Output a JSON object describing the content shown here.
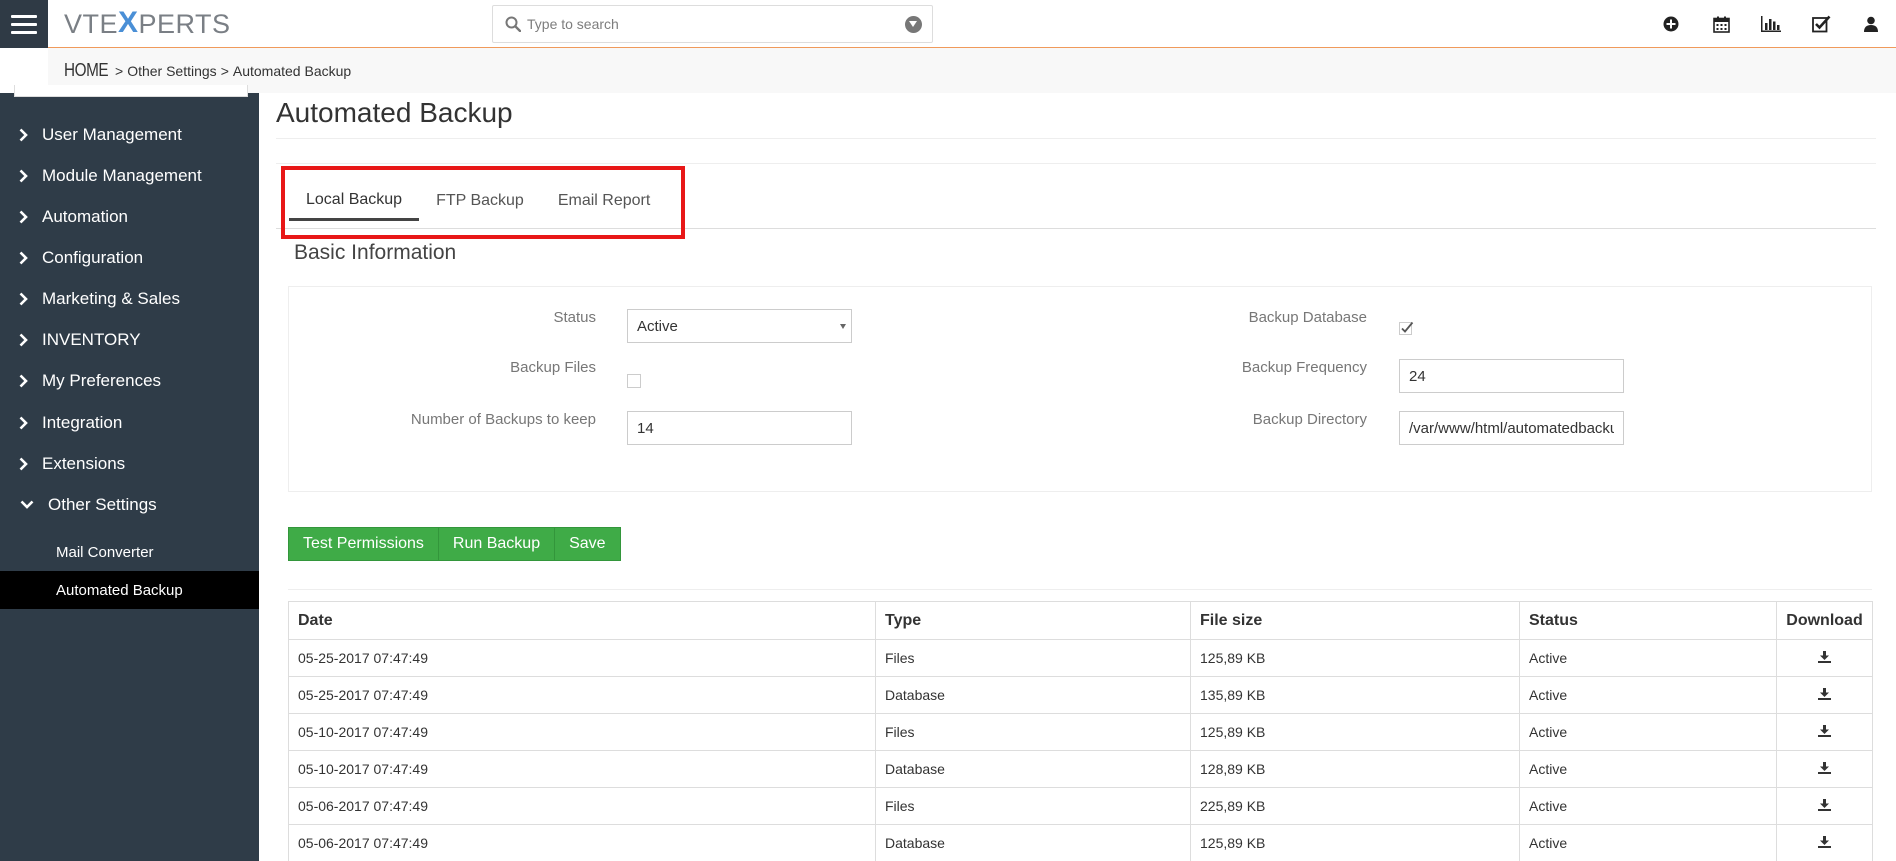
{
  "app": {
    "logo_left": "VTE",
    "logo_x": "X",
    "logo_right": "PERTS",
    "search_placeholder": "Type to search",
    "top_icons": [
      "plus-circle-icon",
      "calendar-icon",
      "bar-chart-icon",
      "checkbox-icon",
      "user-icon"
    ]
  },
  "breadcrumb": {
    "home": "HOME",
    "level1": "Other Settings",
    "level2": "Automated Backup",
    "sep1": ">",
    "sep2": ">"
  },
  "sidebar": {
    "items": [
      {
        "label": "User Management",
        "expanded": false
      },
      {
        "label": "Module Management",
        "expanded": false
      },
      {
        "label": "Automation",
        "expanded": false
      },
      {
        "label": "Configuration",
        "expanded": false
      },
      {
        "label": "Marketing & Sales",
        "expanded": false
      },
      {
        "label": "INVENTORY",
        "expanded": false
      },
      {
        "label": "My Preferences",
        "expanded": false
      },
      {
        "label": "Integration",
        "expanded": false
      },
      {
        "label": "Extensions",
        "expanded": false
      },
      {
        "label": "Other Settings",
        "expanded": true
      }
    ],
    "subitems": [
      {
        "label": "Mail Converter",
        "active": false
      },
      {
        "label": "Automated Backup",
        "active": true
      }
    ]
  },
  "page": {
    "title": "Automated Backup",
    "tabs": [
      "Local Backup",
      "FTP Backup",
      "Email Report"
    ],
    "active_tab": "Local Backup",
    "section_title": "Basic Information"
  },
  "form": {
    "status_label": "Status",
    "status_value": "Active",
    "backup_files_label": "Backup Files",
    "backup_files_checked": false,
    "num_backups_label": "Number of Backups to keep",
    "num_backups_value": "14",
    "backup_database_label": "Backup Database",
    "backup_database_checked": true,
    "backup_frequency_label": "Backup Frequency",
    "backup_frequency_value": "24",
    "backup_directory_label": "Backup Directory",
    "backup_directory_value": "/var/www/html/automatedbacku"
  },
  "buttons": {
    "test_permissions": "Test Permissions",
    "run_backup": "Run Backup",
    "save": "Save"
  },
  "table": {
    "headers": [
      "Date",
      "Type",
      "File size",
      "Status",
      "Download"
    ],
    "rows": [
      {
        "date": "05-25-2017 07:47:49",
        "type": "Files",
        "size": "125,89 KB",
        "status": "Active"
      },
      {
        "date": "05-25-2017 07:47:49",
        "type": "Database",
        "size": "135,89 KB",
        "status": "Active"
      },
      {
        "date": "05-10-2017 07:47:49",
        "type": "Files",
        "size": "125,89 KB",
        "status": "Active"
      },
      {
        "date": "05-10-2017 07:47:49",
        "type": "Database",
        "size": "128,89 KB",
        "status": "Active"
      },
      {
        "date": "05-06-2017 07:47:49",
        "type": "Files",
        "size": "225,89 KB",
        "status": "Active"
      },
      {
        "date": "05-06-2017 07:47:49",
        "type": "Database",
        "size": "125,89 KB",
        "status": "Active"
      }
    ]
  },
  "colors": {
    "sidebar_bg": "#2f3c48",
    "accent_orange": "#f09a5b",
    "button_green": "#3fab47",
    "highlight_red": "#e81717",
    "logo_blue": "#4a8fd6"
  }
}
